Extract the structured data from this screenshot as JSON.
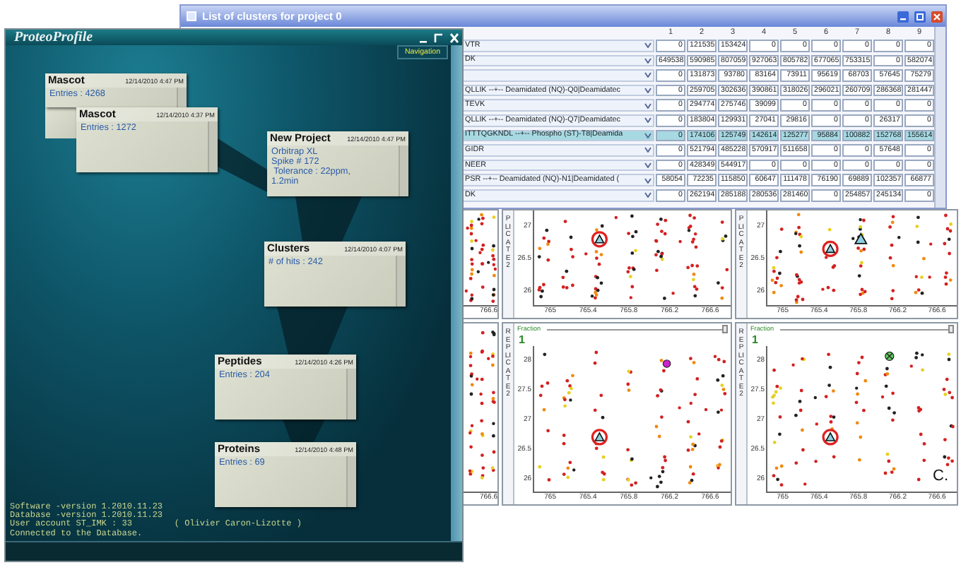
{
  "left_window": {
    "title": "ProteoProfile",
    "navigation_button": "Navigation",
    "nodes": [
      {
        "title": "Mascot",
        "date": "12/14/2010 4:47 PM",
        "lines": [
          "Entries : 4268"
        ]
      },
      {
        "title": "Mascot",
        "date": "12/14/2010 4:37 PM",
        "lines": [
          "Entries : 1272"
        ]
      },
      {
        "title": "New Project",
        "date": "12/14/2010 4:47 PM",
        "lines": [
          "Orbitrap XL",
          "Spike # 172",
          " Tolerance : 22ppm,",
          "1.2min"
        ]
      },
      {
        "title": "Clusters",
        "date": "12/14/2010 4:07 PM",
        "lines": [
          "# of hits : 242"
        ]
      },
      {
        "title": "Peptides",
        "date": "12/14/2010 4:26 PM",
        "lines": [
          "Entries : 204"
        ]
      },
      {
        "title": "Proteins",
        "date": "12/14/2010 4:48 PM",
        "lines": [
          "Entries : 69"
        ]
      }
    ],
    "status_lines": [
      [
        "Software -version 1.2010.11.23"
      ],
      [
        "Database -version 1.2010.11.23"
      ],
      [
        "User account ST_IMK : 33",
        "( Olivier Caron-Lizotte )"
      ],
      [
        "Connected to the Database."
      ]
    ]
  },
  "cluster_window": {
    "title": "List of clusters for project 0",
    "columns": [
      "1",
      "2",
      "3",
      "4",
      "5",
      "6",
      "7",
      "8",
      "9"
    ],
    "rows": [
      {
        "label": "VTR",
        "selected": false,
        "values": [
          "0",
          "121535",
          "153424",
          "0",
          "0",
          "0",
          "0",
          "0",
          "0"
        ]
      },
      {
        "label": "DK",
        "selected": false,
        "values": [
          "649538",
          "590985",
          "807059",
          "927063",
          "805782",
          "677065",
          "753315",
          "0",
          "582074"
        ]
      },
      {
        "label": "",
        "selected": false,
        "values": [
          "0",
          "131873",
          "93780",
          "83164",
          "73911",
          "95619",
          "68703",
          "57645",
          "75279"
        ]
      },
      {
        "label": "QLLIK --+-- Deamidated (NQ)-Q0|Deamidatec",
        "selected": false,
        "values": [
          "0",
          "259705",
          "302636",
          "390861",
          "318026",
          "296021",
          "260709",
          "286368",
          "281447"
        ]
      },
      {
        "label": "TEVK",
        "selected": false,
        "values": [
          "0",
          "294774",
          "275746",
          "39099",
          "0",
          "0",
          "0",
          "0",
          "0"
        ]
      },
      {
        "label": "QLLIK --+-- Deamidated (NQ)-Q7|Deamidatec",
        "selected": false,
        "values": [
          "0",
          "183804",
          "129931",
          "27041",
          "29816",
          "0",
          "0",
          "26317",
          "0"
        ]
      },
      {
        "label": "ITTTQGKNDL --+-- Phospho (ST)-T8|Deamida",
        "selected": true,
        "values": [
          "0",
          "174106",
          "125749",
          "142614",
          "125277",
          "95884",
          "100882",
          "152768",
          "155614"
        ]
      },
      {
        "label": "GIDR",
        "selected": false,
        "values": [
          "0",
          "521794",
          "485228",
          "570917",
          "511658",
          "0",
          "0",
          "57648",
          "0"
        ]
      },
      {
        "label": "NEER",
        "selected": false,
        "values": [
          "0",
          "428349",
          "544917",
          "0",
          "0",
          "0",
          "0",
          "0",
          "0"
        ]
      },
      {
        "label": "PSR --+-- Deamidated (NQ)-N1|Deamidated (",
        "selected": false,
        "values": [
          "58054",
          "72235",
          "115850",
          "60647",
          "111478",
          "76190",
          "69889",
          "102357",
          "66877"
        ]
      },
      {
        "label": "DK",
        "selected": false,
        "values": [
          "0",
          "262194",
          "285188",
          "280536",
          "281460",
          "0",
          "254857",
          "245134",
          "0"
        ]
      }
    ]
  },
  "plots": [
    {
      "kind": "partial",
      "x_ticks": [
        "766.6"
      ]
    },
    {
      "kind": "full",
      "axis_label": "PLICATE 2",
      "y_ticks": [
        "27",
        "26.5",
        "26"
      ],
      "x_ticks": [
        "765",
        "765.4",
        "765.8",
        "766.2",
        "766.6"
      ]
    },
    {
      "kind": "full",
      "axis_label": "PLICATE 2",
      "y_ticks": [
        "27",
        "26.5",
        "26"
      ],
      "x_ticks": [
        "765",
        "765.4",
        "765.8",
        "766.2",
        "766.6"
      ]
    },
    {
      "kind": "partial",
      "x_ticks": [
        "766.6"
      ]
    },
    {
      "kind": "full",
      "axis_label": "REPLICATE 2",
      "fraction_label": "Fraction",
      "fraction": "1",
      "slider": {
        "level": 1
      },
      "y_ticks": [
        "28",
        "27.5",
        "27",
        "26.5",
        "26"
      ],
      "x_ticks": [
        "765",
        "765.4",
        "765.8",
        "766.2",
        "766.6"
      ]
    },
    {
      "kind": "full",
      "axis_label": "REPLICATE 2",
      "fraction_label": "Fraction",
      "fraction": "1",
      "slider": {
        "level": 1
      },
      "y_ticks": [
        "28",
        "27.5",
        "27",
        "26.5",
        "26"
      ],
      "x_ticks": [
        "765",
        "765.4",
        "765.8",
        "766.2",
        "766.6"
      ],
      "panel_letter": "C."
    }
  ]
}
